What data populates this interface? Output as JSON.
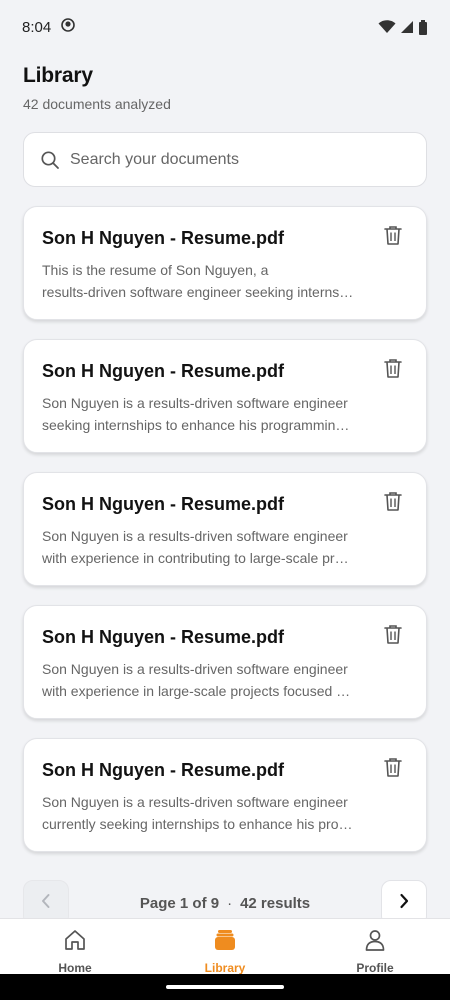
{
  "status_bar": {
    "time": "8:04"
  },
  "header": {
    "title": "Library",
    "subtitle": "42 documents analyzed"
  },
  "search": {
    "placeholder": "Search your documents"
  },
  "documents": [
    {
      "title": "Son H Nguyen - Resume.pdf",
      "line1": "This is the resume of Son Nguyen, a",
      "line2": "results-driven software engineer seeking interns…"
    },
    {
      "title": "Son H Nguyen - Resume.pdf",
      "line1": "Son Nguyen is a results-driven software engineer",
      "line2": "seeking internships to enhance his programmin…"
    },
    {
      "title": "Son H Nguyen - Resume.pdf",
      "line1": "Son Nguyen is a results-driven software engineer",
      "line2": "with experience in contributing to large-scale pr…"
    },
    {
      "title": "Son H Nguyen - Resume.pdf",
      "line1": "Son Nguyen is a results-driven software engineer",
      "line2": "with experience in large-scale projects focused …"
    },
    {
      "title": "Son H Nguyen - Resume.pdf",
      "line1": "Son Nguyen is a results-driven software engineer",
      "line2": "currently seeking internships to enhance his pro…"
    }
  ],
  "pagination": {
    "page_label": "Page 1 of 9",
    "separator": "·",
    "results_label": "42 results"
  },
  "bottom_nav": {
    "home": "Home",
    "library": "Library",
    "profile": "Profile"
  },
  "colors": {
    "accent": "#ef8c1f",
    "background": "#f2f3f6"
  }
}
